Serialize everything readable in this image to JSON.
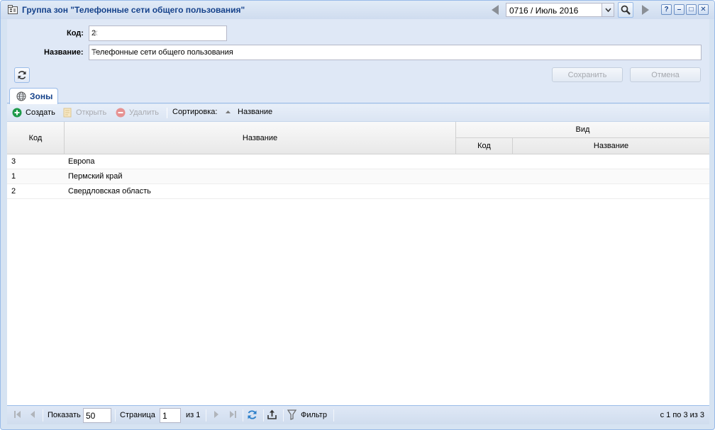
{
  "window": {
    "title": "Группа зон \"Телефонные сети общего пользования\"",
    "period": "0716 / Июль 2016",
    "help_label": "?",
    "minimize_label": "–",
    "maximize_label": "□",
    "close_label": "✕"
  },
  "form": {
    "code_label": "Код:",
    "code_value": "2",
    "name_label": "Название:",
    "name_value": "Телефонные сети общего пользования",
    "save_label": "Сохранить",
    "cancel_label": "Отмена"
  },
  "tabs": [
    {
      "label": "Зоны",
      "icon": "globe-icon",
      "active": true
    }
  ],
  "toolbar": {
    "create_label": "Создать",
    "open_label": "Открыть",
    "delete_label": "Удалить",
    "sort_label": "Сортировка:",
    "sort_field": "Название"
  },
  "grid": {
    "columns": {
      "code": "Код",
      "name": "Название",
      "kind_group": "Вид",
      "kind_code": "Код",
      "kind_name": "Название"
    },
    "rows": [
      {
        "code": "3",
        "name": "Европа",
        "kind_code": "",
        "kind_name": ""
      },
      {
        "code": "1",
        "name": "Пермский край",
        "kind_code": "",
        "kind_name": ""
      },
      {
        "code": "2",
        "name": "Свердловская область",
        "kind_code": "",
        "kind_name": ""
      }
    ]
  },
  "pager": {
    "show_label": "Показать",
    "page_size": "50",
    "page_label": "Страница",
    "page_value": "1",
    "of_label": "из 1",
    "filter_label": "Фильтр",
    "summary": "с 1 по 3 из 3"
  },
  "colors": {
    "accent": "#15428b",
    "frame": "#99bbe8",
    "panel": "#dfe8f6",
    "create_icon": "#1e9a4a",
    "delete_icon": "#e07b7b"
  }
}
